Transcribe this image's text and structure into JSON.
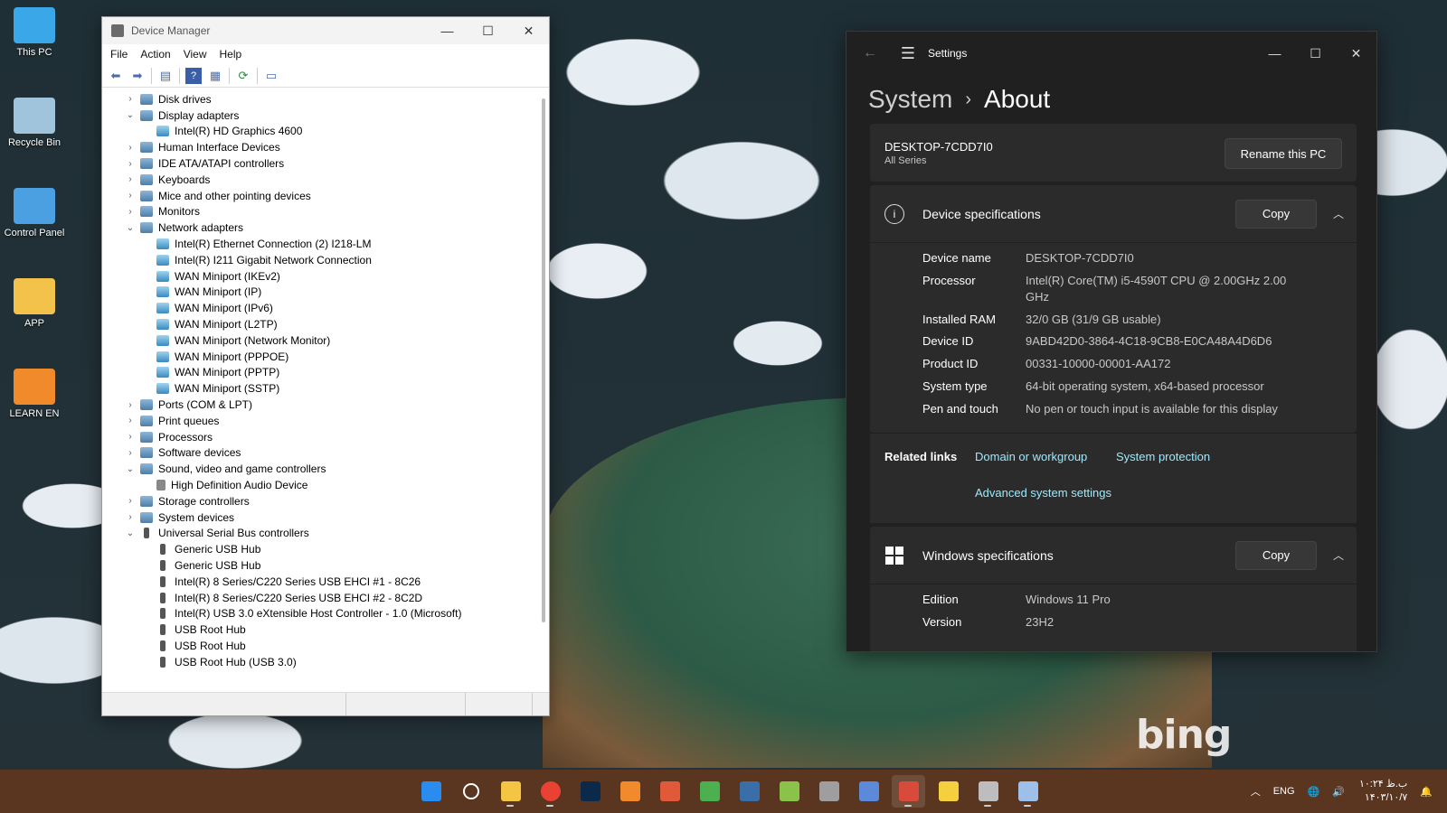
{
  "desktop": {
    "icons": [
      {
        "label": "This PC",
        "color": "#3aa8e8"
      },
      {
        "label": "Recycle Bin",
        "color": "#9fc4dc"
      },
      {
        "label": "Control Panel",
        "color": "#4aa0e0"
      },
      {
        "label": "APP",
        "color": "#f2c24a"
      },
      {
        "label": "LEARN EN",
        "color": "#f08a2a"
      }
    ],
    "watermark": "bing"
  },
  "device_manager": {
    "title": "Device Manager",
    "menu": [
      "File",
      "Action",
      "View",
      "Help"
    ],
    "tree": [
      {
        "label": "Disk drives",
        "level": 0,
        "state": "collapsed"
      },
      {
        "label": "Display adapters",
        "level": 0,
        "state": "expanded"
      },
      {
        "label": "Intel(R) HD Graphics 4600",
        "level": 1
      },
      {
        "label": "Human Interface Devices",
        "level": 0,
        "state": "collapsed"
      },
      {
        "label": "IDE ATA/ATAPI controllers",
        "level": 0,
        "state": "collapsed"
      },
      {
        "label": "Keyboards",
        "level": 0,
        "state": "collapsed"
      },
      {
        "label": "Mice and other pointing devices",
        "level": 0,
        "state": "collapsed"
      },
      {
        "label": "Monitors",
        "level": 0,
        "state": "collapsed"
      },
      {
        "label": "Network adapters",
        "level": 0,
        "state": "expanded"
      },
      {
        "label": "Intel(R) Ethernet Connection (2) I218-LM",
        "level": 1
      },
      {
        "label": "Intel(R) I211 Gigabit Network Connection",
        "level": 1
      },
      {
        "label": "WAN Miniport (IKEv2)",
        "level": 1
      },
      {
        "label": "WAN Miniport (IP)",
        "level": 1
      },
      {
        "label": "WAN Miniport (IPv6)",
        "level": 1
      },
      {
        "label": "WAN Miniport (L2TP)",
        "level": 1
      },
      {
        "label": "WAN Miniport (Network Monitor)",
        "level": 1
      },
      {
        "label": "WAN Miniport (PPPOE)",
        "level": 1
      },
      {
        "label": "WAN Miniport (PPTP)",
        "level": 1
      },
      {
        "label": "WAN Miniport (SSTP)",
        "level": 1
      },
      {
        "label": "Ports (COM & LPT)",
        "level": 0,
        "state": "collapsed"
      },
      {
        "label": "Print queues",
        "level": 0,
        "state": "collapsed"
      },
      {
        "label": "Processors",
        "level": 0,
        "state": "collapsed"
      },
      {
        "label": "Software devices",
        "level": 0,
        "state": "collapsed"
      },
      {
        "label": "Sound, video and game controllers",
        "level": 0,
        "state": "expanded"
      },
      {
        "label": "High Definition Audio Device",
        "level": 1,
        "kind": "sound"
      },
      {
        "label": "Storage controllers",
        "level": 0,
        "state": "collapsed"
      },
      {
        "label": "System devices",
        "level": 0,
        "state": "collapsed"
      },
      {
        "label": "Universal Serial Bus controllers",
        "level": 0,
        "state": "expanded",
        "kind": "usb"
      },
      {
        "label": "Generic USB Hub",
        "level": 1,
        "kind": "usb"
      },
      {
        "label": "Generic USB Hub",
        "level": 1,
        "kind": "usb"
      },
      {
        "label": "Intel(R) 8 Series/C220 Series USB EHCI #1 - 8C26",
        "level": 1,
        "kind": "usb"
      },
      {
        "label": "Intel(R) 8 Series/C220 Series USB EHCI #2 - 8C2D",
        "level": 1,
        "kind": "usb"
      },
      {
        "label": "Intel(R) USB 3.0 eXtensible Host Controller - 1.0 (Microsoft)",
        "level": 1,
        "kind": "usb"
      },
      {
        "label": "USB Root Hub",
        "level": 1,
        "kind": "usb"
      },
      {
        "label": "USB Root Hub",
        "level": 1,
        "kind": "usb"
      },
      {
        "label": "USB Root Hub (USB 3.0)",
        "level": 1,
        "kind": "usb"
      }
    ]
  },
  "settings": {
    "app_title": "Settings",
    "breadcrumb": {
      "parent": "System",
      "separator": "›",
      "current": "About"
    },
    "pc": {
      "name": "DESKTOP-7CDD7I0",
      "subtitle": "All Series",
      "rename_label": "Rename this PC"
    },
    "device_specs": {
      "title": "Device specifications",
      "copy_label": "Copy",
      "rows": [
        {
          "key": "Device name",
          "value": "DESKTOP-7CDD7I0"
        },
        {
          "key": "Processor",
          "value": "Intel(R) Core(TM) i5-4590T CPU @ 2.00GHz   2.00 GHz"
        },
        {
          "key": "Installed RAM",
          "value": "32/0 GB (31/9 GB usable)"
        },
        {
          "key": "Device ID",
          "value": "9ABD42D0-3864-4C18-9CB8-E0CA48A4D6D6"
        },
        {
          "key": "Product ID",
          "value": "00331-10000-00001-AA172"
        },
        {
          "key": "System type",
          "value": "64-bit operating system, x64-based processor"
        },
        {
          "key": "Pen and touch",
          "value": "No pen or touch input is available for this display"
        }
      ]
    },
    "related_links": {
      "label": "Related links",
      "links": [
        "Domain or workgroup",
        "System protection",
        "Advanced system settings"
      ]
    },
    "windows_specs": {
      "title": "Windows specifications",
      "copy_label": "Copy",
      "rows": [
        {
          "key": "Edition",
          "value": "Windows 11 Pro"
        },
        {
          "key": "Version",
          "value": "23H2"
        }
      ]
    }
  },
  "taskbar": {
    "apps": [
      {
        "name": "start-icon",
        "color": "#2b8cf0"
      },
      {
        "name": "search-icon",
        "color": "#ffffff"
      },
      {
        "name": "file-explorer-icon",
        "color": "#f4c542"
      },
      {
        "name": "chrome-icon",
        "color": "#e94235"
      },
      {
        "name": "photoshop-icon",
        "color": "#0b2a4a"
      },
      {
        "name": "app-icon-6",
        "color": "#f08a2a"
      },
      {
        "name": "app-icon-7",
        "color": "#e05a3a"
      },
      {
        "name": "app-icon-8",
        "color": "#4caf50"
      },
      {
        "name": "app-icon-9",
        "color": "#3a6ea8"
      },
      {
        "name": "app-icon-10",
        "color": "#8bc34a"
      },
      {
        "name": "app-icon-11",
        "color": "#9e9e9e"
      },
      {
        "name": "app-icon-12",
        "color": "#5c8ad8"
      },
      {
        "name": "device-manager-taskbar-icon",
        "color": "#d84a3a"
      },
      {
        "name": "app-icon-14",
        "color": "#f4d03f"
      },
      {
        "name": "app-icon-15",
        "color": "#bdbdbd"
      },
      {
        "name": "settings-taskbar-icon",
        "color": "#9ec0e8"
      }
    ],
    "language": "ENG",
    "time": "۱۰:۲۴ ب.ظ",
    "date": "۱۴۰۳/۱۰/۷"
  }
}
